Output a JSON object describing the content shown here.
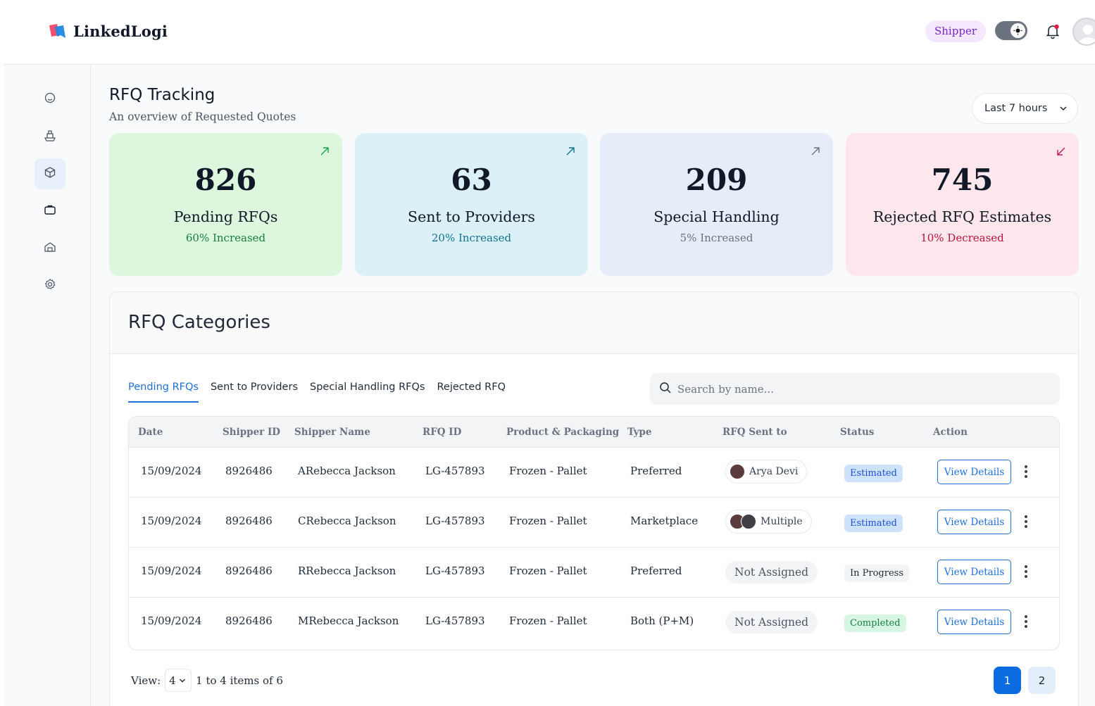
{
  "header": {
    "brand": "LinkedLogi",
    "role": "Shipper",
    "colors": {
      "brand_red": "#f0506e",
      "brand_blue": "#1e88e5"
    }
  },
  "sidebar": {
    "items": [
      {
        "name": "home",
        "icon": "home-icon",
        "active": false
      },
      {
        "name": "shipments",
        "icon": "ship-icon",
        "active": false
      },
      {
        "name": "rfq",
        "icon": "box-icon",
        "active": true
      },
      {
        "name": "jobs",
        "icon": "briefcase-icon",
        "active": false
      },
      {
        "name": "warehouse",
        "icon": "warehouse-icon",
        "active": false
      },
      {
        "name": "settings",
        "icon": "gear-icon",
        "active": false
      }
    ]
  },
  "page": {
    "title": "RFQ Tracking",
    "subtitle": "An overview of Requested Quotes",
    "range": "Last 7 hours"
  },
  "stats": [
    {
      "value": "826",
      "label": "Pending RFQs",
      "delta": "60% Increased",
      "trend": "up",
      "bg": "#dcf7dd",
      "delta_color": "#15803d",
      "arrow_color": "#16a34a"
    },
    {
      "value": "63",
      "label": "Sent to Providers",
      "delta": "20% Increased",
      "trend": "up",
      "bg": "#dcf1f7",
      "delta_color": "#0e7490",
      "arrow_color": "#0e7490"
    },
    {
      "value": "209",
      "label": "Special Handling",
      "delta": "5% Increased",
      "trend": "up",
      "bg": "#e6ecf8",
      "delta_color": "#6b7280",
      "arrow_color": "#6b7280"
    },
    {
      "value": "745",
      "label": "Rejected RFQ Estimates",
      "delta": "10% Decreased",
      "trend": "down",
      "bg": "#fde7ec",
      "delta_color": "#be123c",
      "arrow_color": "#be185d"
    }
  ],
  "categories": {
    "title": "RFQ Categories",
    "tabs": [
      "Pending RFQs",
      "Sent to Providers",
      "Special Handling RFQs",
      "Rejected RFQ"
    ],
    "active_tab": 0,
    "search_placeholder": "Search by name...",
    "columns": [
      "Date",
      "Shipper ID",
      "Shipper Name",
      "RFQ ID",
      "Product & Packaging",
      "Type",
      "RFQ Sent to",
      "Status",
      "Action"
    ],
    "rows": [
      {
        "date": "15/09/2024",
        "shipper_id": "8926486",
        "name": "ARebecca Jackson",
        "rfq_id": "LG-457893",
        "product": "Frozen - Pallet",
        "type": "Preferred",
        "sent_to": "Arya Devi",
        "sent_kind": "person",
        "status": "Estimated",
        "status_kind": "estimated",
        "action": "View Details"
      },
      {
        "date": "15/09/2024",
        "shipper_id": "8926486",
        "name": "CRebecca Jackson",
        "rfq_id": "LG-457893",
        "product": "Frozen - Pallet",
        "type": "Marketplace",
        "sent_to": "Multiple",
        "sent_kind": "multiple",
        "status": "Estimated",
        "status_kind": "estimated",
        "action": "View Details"
      },
      {
        "date": "15/09/2024",
        "shipper_id": "8926486",
        "name": "RRebecca Jackson",
        "rfq_id": "LG-457893",
        "product": "Frozen - Pallet",
        "type": "Preferred",
        "sent_to": "Not Assigned",
        "sent_kind": "none",
        "status": "In Progress",
        "status_kind": "progress",
        "action": "View Details"
      },
      {
        "date": "15/09/2024",
        "shipper_id": "8926486",
        "name": "MRebecca Jackson",
        "rfq_id": "LG-457893",
        "product": "Frozen - Pallet",
        "type": "Both (P+M)",
        "sent_to": "Not Assigned",
        "sent_kind": "none",
        "status": "Completed",
        "status_kind": "completed",
        "action": "View Details"
      }
    ],
    "footer": {
      "view_label": "View:",
      "page_size": "4",
      "summary": "1 to 4 items of 6",
      "pages": [
        "1",
        "2"
      ],
      "current_page": "1"
    }
  }
}
